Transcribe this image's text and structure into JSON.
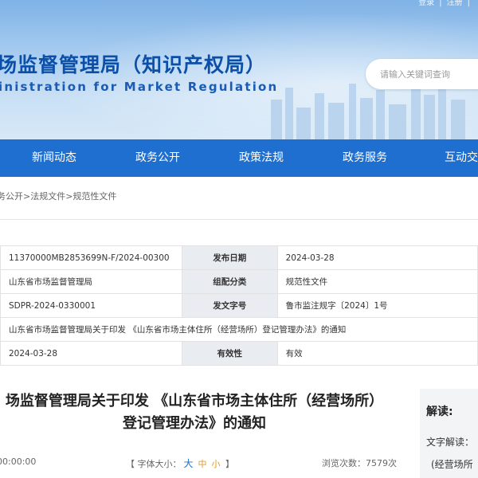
{
  "header": {
    "top_links": [
      "登录",
      "|",
      "注册",
      "|"
    ],
    "title_cn": "场监督管理局（知识产权局）",
    "title_en": "inistration for Market Regulation",
    "search_placeholder": "请输入关键词查询"
  },
  "nav": {
    "items": [
      "新闻动态",
      "政务公开",
      "政策法规",
      "政务服务",
      "互动交"
    ]
  },
  "breadcrumb": "务公开>法规文件>规范性文件",
  "info": {
    "row1": {
      "value": "11370000MB2853699N-F/2024-00300",
      "label": "发布日期",
      "value2": "2024-03-28"
    },
    "row2": {
      "value": "山东省市场监督管理局",
      "label": "组配分类",
      "value2": "规范性文件"
    },
    "row3": {
      "value": "SDPR-2024-0330001",
      "label": "发文字号",
      "value2": "鲁市监注规字〔2024〕1号"
    },
    "row4": {
      "value": "山东省市场监督管理局关于印发 《山东省市场主体住所（经营场所）登记管理办法》的通知"
    },
    "row5": {
      "value": "2024-03-28",
      "label": "有效性",
      "value2": "有效"
    }
  },
  "article": {
    "title_line1": "场监督管理局关于印发 《山东省市场主体住所（经营场所）",
    "title_line2": "登记管理办法》的通知",
    "time": "00:00:00",
    "font_label_open": "【 字体大小：",
    "font_big": "大",
    "font_mid": "中",
    "font_small": "小",
    "font_label_close": " 】",
    "views": "浏览次数：7579次"
  },
  "side": {
    "heading": "解读:",
    "line1": "文字解读：",
    "line2": "(经营场所"
  }
}
